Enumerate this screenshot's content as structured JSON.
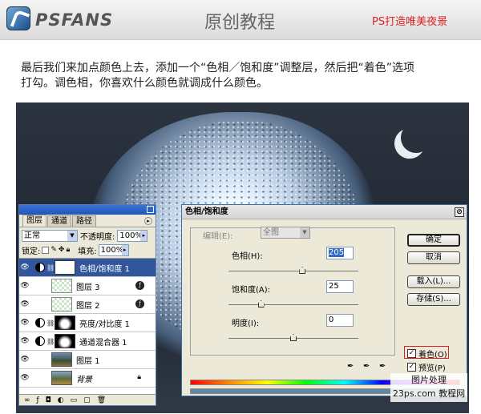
{
  "header": {
    "logo_text": "PSFANS",
    "title": "原创教程",
    "tagline": "PS打造唯美夜景"
  },
  "intro": {
    "line1": "最后我们来加点颜色上去，添加一个“色相／饱和度”调整层，然后把“着色”选项",
    "line2": "打勾。调色相，你喜欢什么颜色就调成什么颜色。"
  },
  "layers_panel": {
    "tabs": [
      "图层",
      "通道",
      "路径"
    ],
    "blend_mode": "正常",
    "opacity_label": "不透明度:",
    "opacity_value": "100%",
    "lock_label": "锁定:",
    "fill_label": "填充:",
    "fill_value": "100%",
    "layers": [
      {
        "name": "色相/饱和度 1",
        "type": "adjustment",
        "selected": true
      },
      {
        "name": "图层 3",
        "type": "pixel"
      },
      {
        "name": "图层 2",
        "type": "pixel"
      },
      {
        "name": "亮度/对比度 1",
        "type": "adjustment"
      },
      {
        "name": "通道混合器 1",
        "type": "adjustment"
      },
      {
        "name": "图层 1",
        "type": "image"
      },
      {
        "name": "背景",
        "type": "background"
      }
    ]
  },
  "dialog": {
    "title": "色相/饱和度",
    "edit_label": "编辑(E):",
    "edit_value": "全图",
    "hue_label": "色相(H):",
    "hue_value": "205",
    "hue_value_num": 205,
    "saturation_label": "饱和度(A):",
    "saturation_value": "25",
    "saturation_value_num": 25,
    "lightness_label": "明度(I):",
    "lightness_value": "0",
    "lightness_value_num": 0,
    "buttons": {
      "ok": "确定",
      "cancel": "取消",
      "load": "载入(L)...",
      "save": "存储(S)..."
    },
    "colorize_label": "着色(O)",
    "colorize_checked": true,
    "preview_label": "预览(P)",
    "preview_checked": true
  },
  "watermark": {
    "line1": "图片处理",
    "line2": "23ps.com 教程网"
  }
}
